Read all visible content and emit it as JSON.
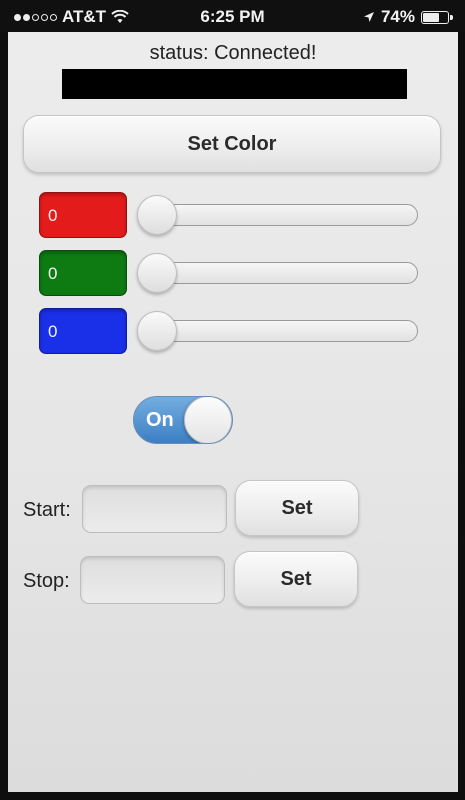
{
  "status_bar": {
    "carrier": "AT&T",
    "time": "6:25 PM",
    "battery": "74%",
    "battery_level": 0.74,
    "signal_bars_filled": 2,
    "signal_bars_total": 5
  },
  "status": {
    "text": "status: Connected!"
  },
  "set_color_button": {
    "label": "Set Color"
  },
  "colors": [
    {
      "name": "red",
      "value": "0",
      "color": "#e31b1b",
      "slider_value": 0
    },
    {
      "name": "green",
      "value": "0",
      "color": "#0d7a12",
      "slider_value": 0
    },
    {
      "name": "blue",
      "value": "0",
      "color": "#1a2fe8",
      "slider_value": 0
    }
  ],
  "toggle": {
    "label": "On",
    "state": "on"
  },
  "start": {
    "label": "Start:",
    "value": "",
    "button": "Set"
  },
  "stop": {
    "label": "Stop:",
    "value": "",
    "button": "Set"
  }
}
